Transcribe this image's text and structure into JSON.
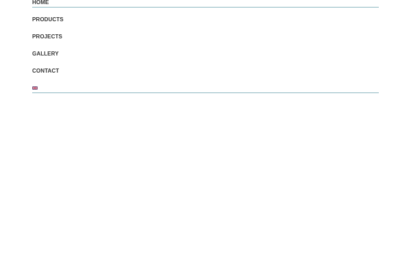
{
  "nav": {
    "items": [
      {
        "label": "HOME"
      },
      {
        "label": "PRODUCTS"
      },
      {
        "label": "PROJECTS"
      },
      {
        "label": "GALLERY"
      },
      {
        "label": "CONTACT"
      }
    ],
    "language": {
      "icon": "uk-flag-icon"
    }
  },
  "colors": {
    "text": "#333333",
    "divider": "#8fb8c2",
    "background": "#ffffff"
  }
}
